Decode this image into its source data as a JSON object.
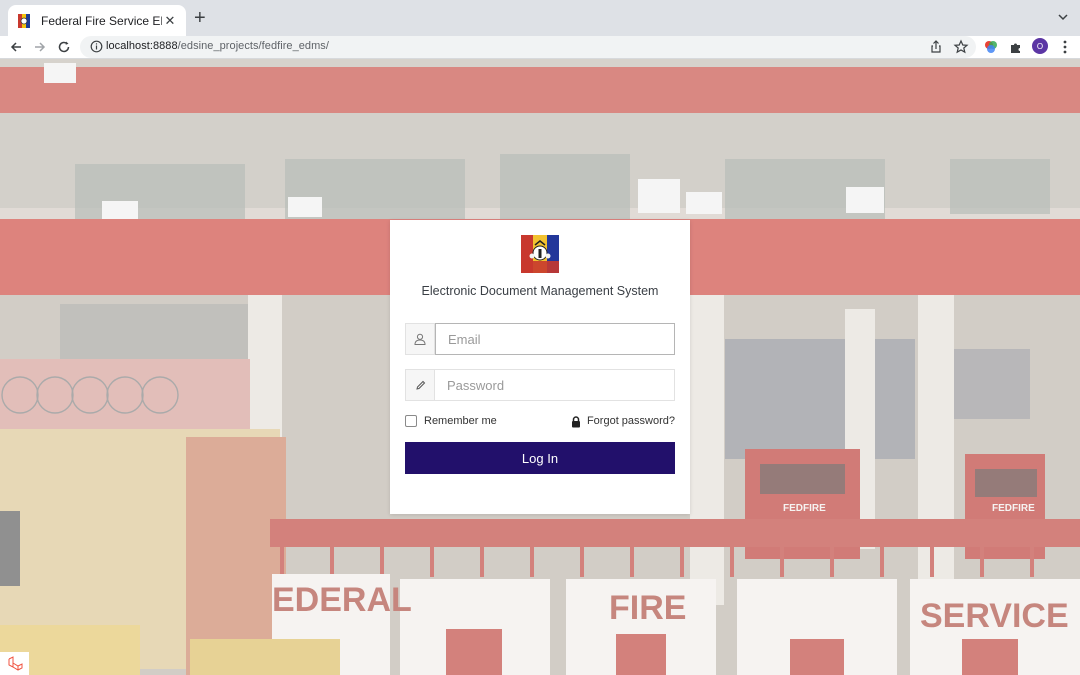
{
  "browser": {
    "tab_title": "Federal Fire Service EDMS",
    "tab_favicon": "nigeria-coat-of-arms-icon",
    "close_icon": "close-icon",
    "new_tab_icon": "plus-icon",
    "url_host": "localhost:8888",
    "url_path": "/edsine_projects/fedfire_edms/",
    "profile_initial": "O"
  },
  "login": {
    "logo_icon": "fedfire-crest-icon",
    "system_name": "Electronic Document Management System",
    "email_placeholder": "Email",
    "password_placeholder": "Password",
    "remember_label": "Remember me",
    "forgot_label": "Forgot password?",
    "submit_label": "Log In"
  },
  "background": {
    "building_signage": [
      "EDERAL",
      "FIRE",
      "SERVICE",
      "FEDFIRE",
      "FEDFIRE"
    ]
  },
  "colors": {
    "primary_button": "#22106b",
    "card_background": "#ffffff",
    "building_red": "#c8382e"
  }
}
